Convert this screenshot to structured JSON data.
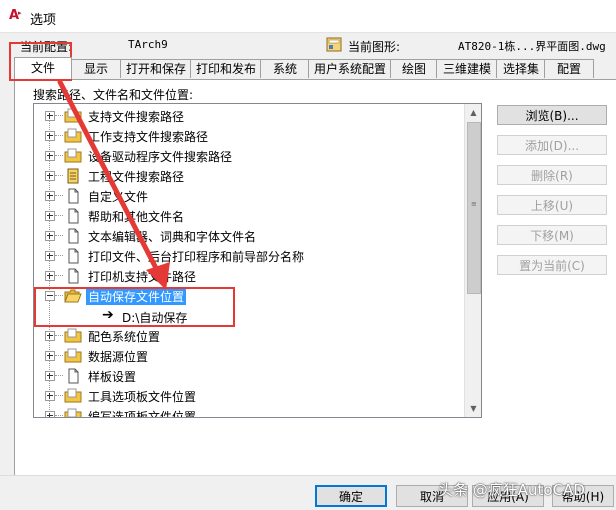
{
  "window": {
    "title": "选项"
  },
  "header": {
    "current_profile_label": "当前配置:",
    "current_profile_value": "TArch9",
    "current_drawing_label": "当前图形:",
    "current_drawing_value": "AT820-1栋...界平面图.dwg"
  },
  "tabs": [
    {
      "label": "文件",
      "active": true
    },
    {
      "label": "显示"
    },
    {
      "label": "打开和保存"
    },
    {
      "label": "打印和发布"
    },
    {
      "label": "系统"
    },
    {
      "label": "用户系统配置"
    },
    {
      "label": "绘图"
    },
    {
      "label": "三维建模"
    },
    {
      "label": "选择集"
    },
    {
      "label": "配置"
    }
  ],
  "section": {
    "label": "搜索路径、文件名和文件位置:"
  },
  "tree": {
    "items": [
      {
        "label": "支持文件搜索路径",
        "icon": "folder-icon"
      },
      {
        "label": "工作支持文件搜索路径",
        "icon": "folder-icon"
      },
      {
        "label": "设备驱动程序文件搜索路径",
        "icon": "folder-icon"
      },
      {
        "label": "工程文件搜索路径",
        "icon": "project-icon"
      },
      {
        "label": "自定义文件",
        "icon": "file-icon"
      },
      {
        "label": "帮助和其他文件名",
        "icon": "file-icon"
      },
      {
        "label": "文本编辑器、词典和字体文件名",
        "icon": "file-icon"
      },
      {
        "label": "打印文件、后台打印程序和前导部分名称",
        "icon": "file-icon"
      },
      {
        "label": "打印机支持文件路径",
        "icon": "file-icon"
      },
      {
        "label": "自动保存文件位置",
        "icon": "folder-open-icon",
        "expanded": true,
        "selected": true
      },
      {
        "label": "配色系统位置",
        "icon": "folder-icon"
      },
      {
        "label": "数据源位置",
        "icon": "folder-icon"
      },
      {
        "label": "样板设置",
        "icon": "file-icon"
      },
      {
        "label": "工具选项板文件位置",
        "icon": "folder-icon"
      },
      {
        "label": "编写选项板文件位置",
        "icon": "folder-icon"
      }
    ],
    "child": {
      "label": "D:\\自动保存",
      "icon": "arrow-right-icon"
    }
  },
  "side_buttons": [
    {
      "label": "浏览(B)...",
      "enabled": true
    },
    {
      "label": "添加(D)...",
      "enabled": false
    },
    {
      "label": "删除(R)",
      "enabled": false
    },
    {
      "label": "上移(U)",
      "enabled": false
    },
    {
      "label": "下移(M)",
      "enabled": false
    },
    {
      "label": "置为当前(C)",
      "enabled": false
    }
  ],
  "bottom_buttons": {
    "ok": "确定",
    "cancel": "取消",
    "apply": "应用(A)",
    "help": "帮助(H)"
  },
  "watermark": "头条 @疯狂AutoCAD",
  "colors": {
    "selection": "#3399ff",
    "callout": "#e53935",
    "folder": "#f4c542"
  }
}
